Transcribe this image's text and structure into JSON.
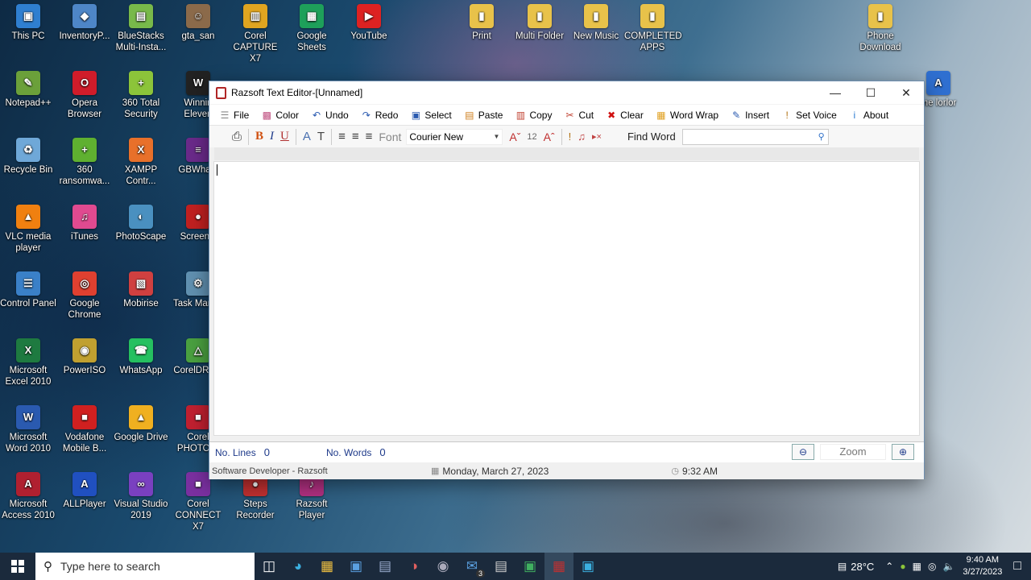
{
  "desktop": {
    "icons": [
      {
        "label": "This PC",
        "glyph": "▣",
        "color": "#2f7fd0"
      },
      {
        "label": "InventoryP...",
        "glyph": "◆",
        "color": "#4e86c7"
      },
      {
        "label": "BlueStacks Multi-Insta...",
        "glyph": "▤",
        "color": "#78b94a"
      },
      {
        "label": "gta_san",
        "glyph": "☺",
        "color": "#8b6a4a"
      },
      {
        "label": "Corel CAPTURE X7",
        "glyph": "▥",
        "color": "#e0a520"
      },
      {
        "label": "Google Sheets",
        "glyph": "▦",
        "color": "#1ea05a"
      },
      {
        "label": "YouTube",
        "glyph": "▶",
        "color": "#d22"
      },
      {
        "label": "Print",
        "glyph": "▮",
        "color": "#e8c24a"
      },
      {
        "label": "Multi Folder",
        "glyph": "▮",
        "color": "#e8c24a"
      },
      {
        "label": "New Music",
        "glyph": "▮",
        "color": "#e8c24a"
      },
      {
        "label": "COMPLETED APPS",
        "glyph": "▮",
        "color": "#e8c24a"
      },
      {
        "label": "Phone Download",
        "glyph": "▮",
        "color": "#e8c24a"
      },
      {
        "label": "Notepad++",
        "glyph": "✎",
        "color": "#6ba03a"
      },
      {
        "label": "Opera Browser",
        "glyph": "O",
        "color": "#d01c2a"
      },
      {
        "label": "360 Total Security",
        "glyph": "+",
        "color": "#8cc43a"
      },
      {
        "label": "Winnin Eleven",
        "glyph": "W",
        "color": "#222"
      },
      {
        "label": "me lorlor",
        "glyph": "A",
        "color": "#2f6fd0"
      },
      {
        "label": "Recycle Bin",
        "glyph": "♻",
        "color": "#6fa8d8"
      },
      {
        "label": "360 ransomwa...",
        "glyph": "+",
        "color": "#5fb030"
      },
      {
        "label": "XAMPP Contr...",
        "glyph": "X",
        "color": "#e8702a"
      },
      {
        "label": "GBWhats",
        "glyph": "≡",
        "color": "#6a2a8a"
      },
      {
        "label": "VLC media player",
        "glyph": "▲",
        "color": "#f08010"
      },
      {
        "label": "iTunes",
        "glyph": "♫",
        "color": "#e04a90"
      },
      {
        "label": "PhotoScape",
        "glyph": "◐",
        "color": "#4a90c0"
      },
      {
        "label": "ScreenR",
        "glyph": "●",
        "color": "#c02020"
      },
      {
        "label": "Control Panel",
        "glyph": "☰",
        "color": "#3a80c8"
      },
      {
        "label": "Google Chrome",
        "glyph": "◎",
        "color": "#e04030"
      },
      {
        "label": "Mobirise",
        "glyph": "▧",
        "color": "#d04040"
      },
      {
        "label": "Task Manag",
        "glyph": "⚙",
        "color": "#6090b0"
      },
      {
        "label": "Microsoft Excel 2010",
        "glyph": "X",
        "color": "#1e7a40"
      },
      {
        "label": "PowerISO",
        "glyph": "◉",
        "color": "#c0a030"
      },
      {
        "label": "WhatsApp",
        "glyph": "☎",
        "color": "#25c060"
      },
      {
        "label": "CorelDR X7",
        "glyph": "△",
        "color": "#4aa040"
      },
      {
        "label": "Microsoft Word 2010",
        "glyph": "W",
        "color": "#2a5ab0"
      },
      {
        "label": "Vodafone Mobile B...",
        "glyph": "■",
        "color": "#d02020"
      },
      {
        "label": "Google Drive",
        "glyph": "▲",
        "color": "#f0b020"
      },
      {
        "label": "Corel PHOTO-P",
        "glyph": "■",
        "color": "#c02030"
      },
      {
        "label": "Microsoft Access 2010",
        "glyph": "A",
        "color": "#b02030"
      },
      {
        "label": "ALLPlayer",
        "glyph": "A",
        "color": "#2050c0"
      },
      {
        "label": "Visual Studio 2019",
        "glyph": "∞",
        "color": "#7a40c0"
      },
      {
        "label": "Corel CONNECT X7",
        "glyph": "■",
        "color": "#7a30a0"
      },
      {
        "label": "Steps Recorder",
        "glyph": "●",
        "color": "#c03030"
      },
      {
        "label": "Razsoft Player",
        "glyph": "♪",
        "color": "#b03080"
      }
    ]
  },
  "window": {
    "title": "Razsoft Text Editor-[Unnamed]",
    "controls": {
      "minimize": "—",
      "maximize": "☐",
      "close": "✕"
    },
    "menu": [
      {
        "label": "File",
        "icon": "☰",
        "color": "#888"
      },
      {
        "label": "Color",
        "icon": "▩",
        "color": "#c05080"
      },
      {
        "label": "Undo",
        "icon": "↶",
        "color": "#2a5ab0"
      },
      {
        "label": "Redo",
        "icon": "↷",
        "color": "#2a5ab0"
      },
      {
        "label": "Select",
        "icon": "▣",
        "color": "#2a5ab0"
      },
      {
        "label": "Paste",
        "icon": "▤",
        "color": "#d08020"
      },
      {
        "label": "Copy",
        "icon": "▥",
        "color": "#c04030"
      },
      {
        "label": "Cut",
        "icon": "✂",
        "color": "#c04030"
      },
      {
        "label": "Clear",
        "icon": "✖",
        "color": "#d01010"
      },
      {
        "label": "Word Wrap",
        "icon": "▦",
        "color": "#e0a020"
      },
      {
        "label": "Insert",
        "icon": "✎",
        "color": "#2a5ab0"
      },
      {
        "label": "Set Voice",
        "icon": "!",
        "color": "#b07010"
      },
      {
        "label": "About",
        "icon": "i",
        "color": "#2a7ad0"
      }
    ],
    "toolbar": {
      "font_label": "Font",
      "font_name": "Courier New",
      "font_size": "12",
      "find_label": "Find Word",
      "find_value": ""
    },
    "status": {
      "lines_label": "No. Lines",
      "lines_value": "0",
      "words_label": "No. Words",
      "words_value": "0",
      "zoom_label": "Zoom",
      "developer": "Software Developer - Razsoft",
      "date": "Monday, March 27, 2023",
      "time": "9:32 AM"
    }
  },
  "taskbar": {
    "search_placeholder": "Type here to search",
    "mail_badge": "3",
    "weather": "28°C",
    "clock_time": "9:40 AM",
    "clock_date": "3/27/2023"
  }
}
